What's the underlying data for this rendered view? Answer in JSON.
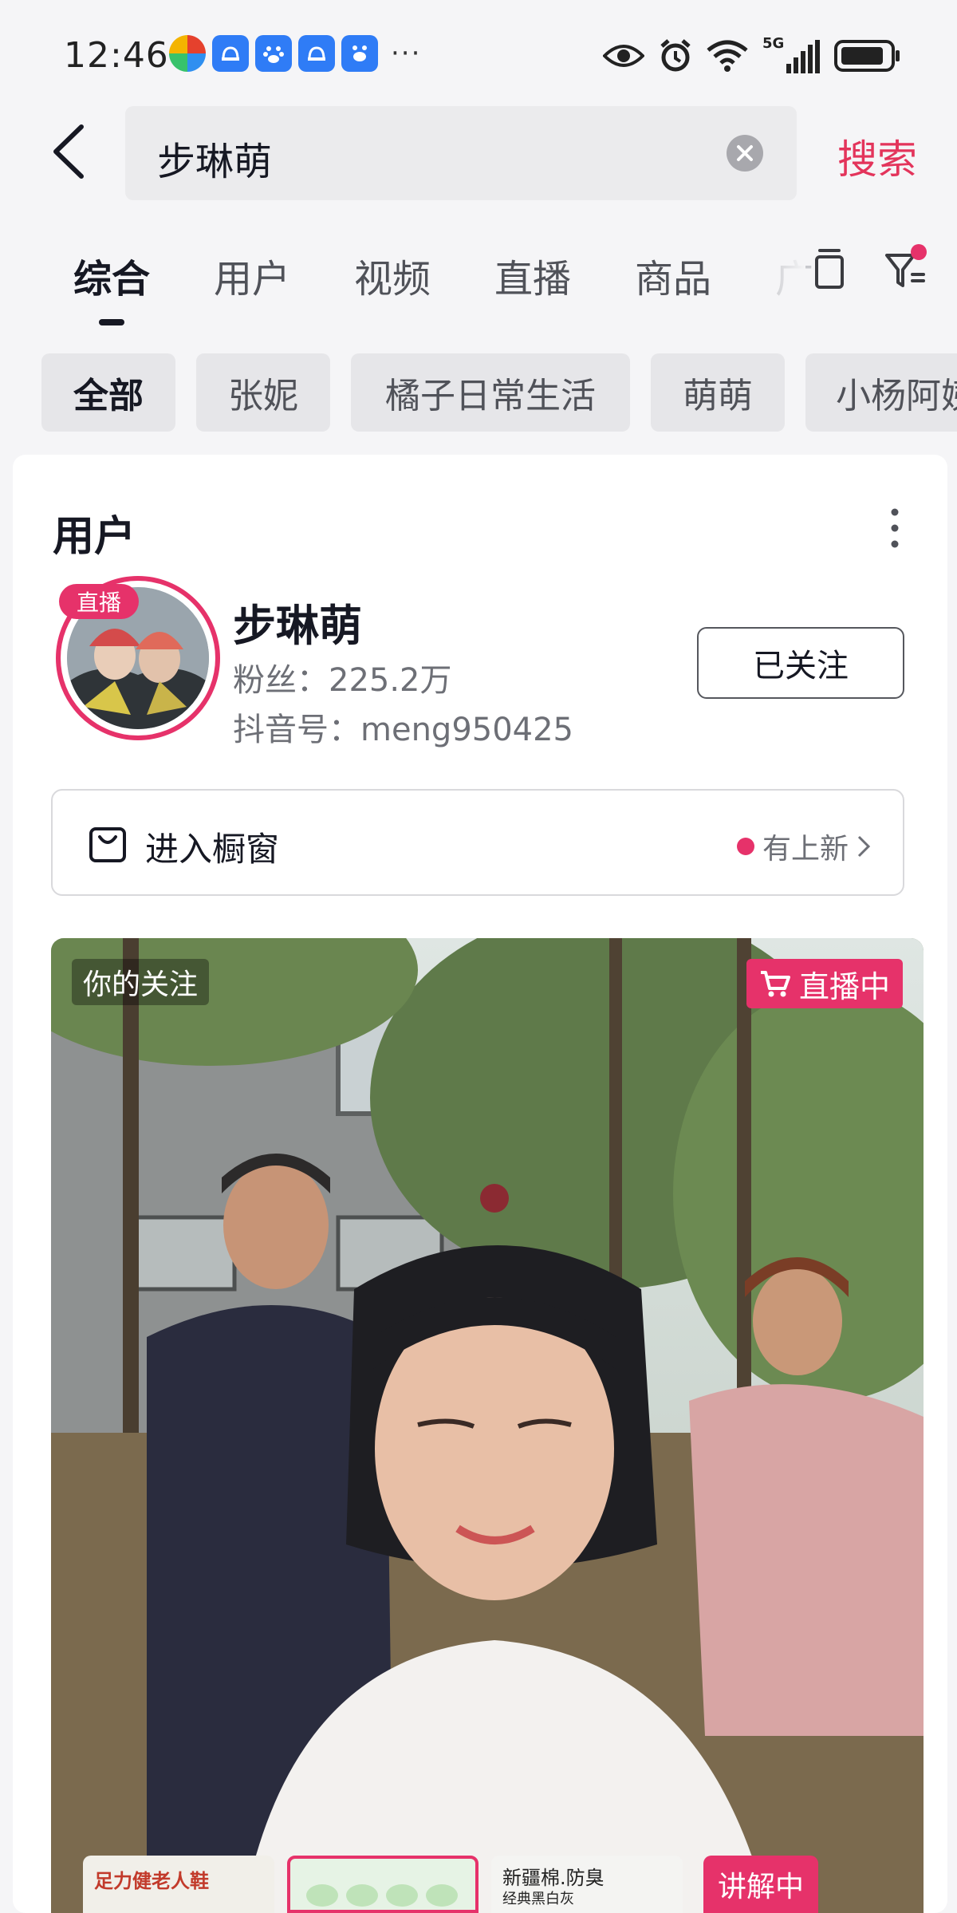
{
  "status_bar": {
    "time": "12:46",
    "dots": "···",
    "network": "5G",
    "app_icons": [
      "multicolor-app-icon",
      "ai-assistant-icon",
      "baidu-icon",
      "ai-assistant-icon",
      "baidu-ai-icon"
    ],
    "status_icons": [
      "eye-icon",
      "alarm-icon",
      "wifi-icon",
      "signal-icon",
      "battery-icon"
    ]
  },
  "search": {
    "query": "步琳萌",
    "submit_label": "搜索"
  },
  "tabs": [
    {
      "label": "综合",
      "active": true
    },
    {
      "label": "用户",
      "active": false
    },
    {
      "label": "视频",
      "active": false
    },
    {
      "label": "直播",
      "active": false
    },
    {
      "label": "商品",
      "active": false
    },
    {
      "label": "广",
      "active": false
    }
  ],
  "chips": [
    {
      "label": "全部",
      "active": true
    },
    {
      "label": "张妮",
      "active": false
    },
    {
      "label": "橘子日常生活",
      "active": false
    },
    {
      "label": "萌萌",
      "active": false
    },
    {
      "label": "小杨阿姨",
      "active": false
    }
  ],
  "users_section": {
    "title": "用户",
    "user": {
      "live_badge": "直播",
      "name": "步琳萌",
      "fans": "粉丝：225.2万",
      "douyin_id": "抖音号：meng950425",
      "follow_label": "已关注"
    },
    "shop": {
      "label": "进入橱窗",
      "new_label": "有上新"
    }
  },
  "video": {
    "following_label": "你的关注",
    "live_label": "直播中",
    "explain_label": "讲解中",
    "product_texts": [
      "足力健老人鞋",
      "新疆棉.防臭",
      "经典黑白灰"
    ]
  },
  "colors": {
    "accent": "#e3345b",
    "live_pink": "#e6326a",
    "text_primary": "#161823",
    "text_secondary": "#6d6f76"
  }
}
